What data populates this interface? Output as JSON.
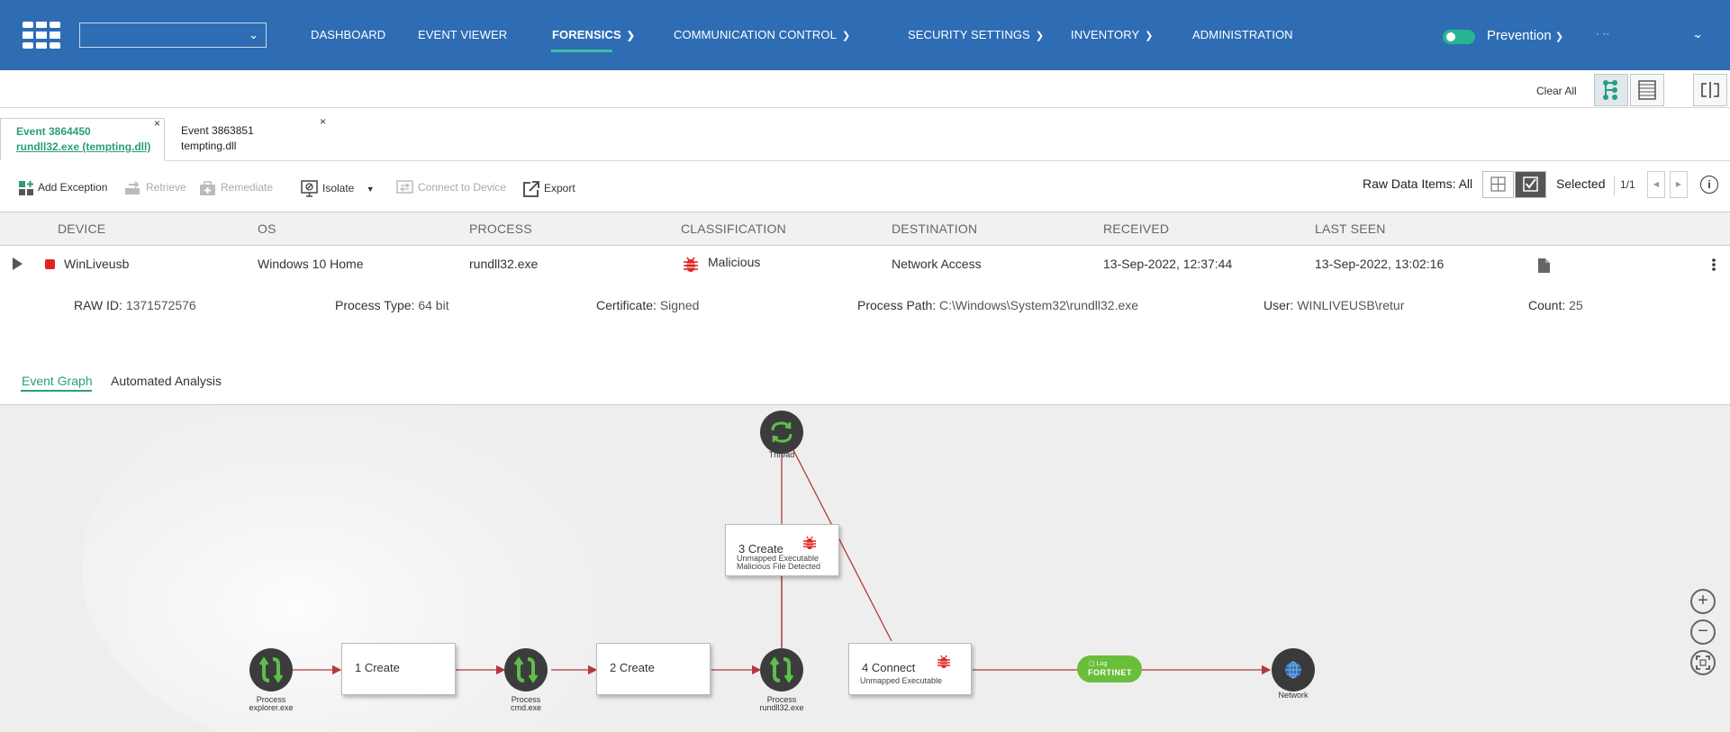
{
  "nav": {
    "tenant_value": "",
    "items": [
      {
        "label": "DASHBOARD",
        "has_caret": false
      },
      {
        "label": "EVENT VIEWER",
        "has_caret": false
      },
      {
        "label": "FORENSICS",
        "has_caret": true
      },
      {
        "label": "COMMUNICATION CONTROL",
        "has_caret": true
      },
      {
        "label": "SECURITY SETTINGS",
        "has_caret": true
      },
      {
        "label": "INVENTORY",
        "has_caret": true
      },
      {
        "label": "ADMINISTRATION",
        "has_caret": false
      }
    ],
    "mode_label": "Prevention",
    "user_label": "· ··",
    "user_dot": "."
  },
  "toolbar": {
    "clear_all": "Clear All"
  },
  "event_tabs": [
    {
      "line1": "Event 3864450",
      "line2": "rundll32.exe (tempting.dll)"
    },
    {
      "line1": "Event 3863851",
      "line2": "tempting.dll"
    }
  ],
  "actions": {
    "add_exception": "Add Exception",
    "retrieve": "Retrieve",
    "remediate": "Remediate",
    "isolate": "Isolate",
    "connect": "Connect to Device",
    "export": "Export",
    "raw_data": "Raw Data Items: All",
    "selected": "Selected",
    "counter": "1/1"
  },
  "table": {
    "headers": [
      "DEVICE",
      "OS",
      "PROCESS",
      "CLASSIFICATION",
      "DESTINATION",
      "RECEIVED",
      "LAST SEEN"
    ],
    "row": {
      "device": "WinLiveusb",
      "os": "Windows 10 Home",
      "process": "rundll32.exe",
      "classification": "Malicious",
      "destination": "Network Access",
      "received": "13-Sep-2022, 12:37:44",
      "last_seen": "13-Sep-2022, 13:02:16"
    },
    "details": [
      {
        "k": "RAW ID:",
        "v": "1371572576"
      },
      {
        "k": "Process Type:",
        "v": "64 bit"
      },
      {
        "k": "Certificate:",
        "v": "Signed"
      },
      {
        "k": "Process Path:",
        "v": "C:\\Windows\\System32\\rundll32.exe"
      },
      {
        "k": "User:",
        "v": "WINLIVEUSB\\retur"
      },
      {
        "k": "Count:",
        "v": "25"
      }
    ]
  },
  "subtabs": [
    "Event Graph",
    "Automated Analysis"
  ],
  "graph": {
    "nodes": [
      {
        "l1": "Process",
        "l2": "explorer.exe"
      },
      {
        "l1": "Process",
        "l2": "cmd.exe"
      },
      {
        "l1": "Process",
        "l2": "rundll32.exe"
      },
      {
        "l1": "Thread",
        "l2": ""
      },
      {
        "l1": "Network",
        "l2": ""
      }
    ],
    "events": [
      {
        "title": "1 Create",
        "sub1": "",
        "sub2": ""
      },
      {
        "title": "2 Create",
        "sub1": "",
        "sub2": ""
      },
      {
        "title": "3 Create",
        "sub1": "Unmapped Executable",
        "sub2": "Malicious File Detected"
      },
      {
        "title": "4 Connect",
        "sub1": "Unmapped Executable",
        "sub2": ""
      }
    ],
    "log_pill": {
      "line1": "Log",
      "line2": "FORTINET"
    }
  },
  "colors": {
    "nav_bg": "#2e6db4",
    "accent": "#2a9d7e",
    "malicious": "#e02424",
    "edge": "#b03a3a",
    "log_pill": "#6abf3a"
  }
}
